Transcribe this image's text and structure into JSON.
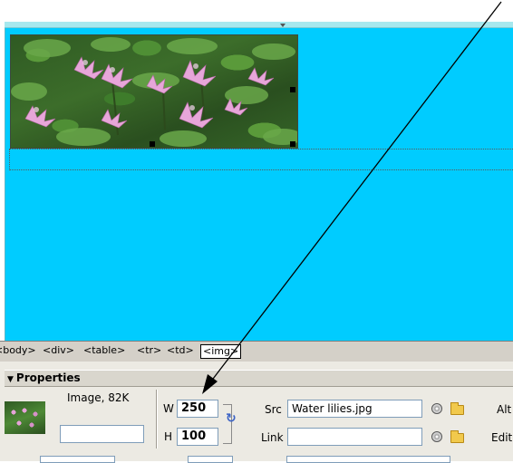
{
  "tag_selector": {
    "tags": [
      "<body>",
      "<div>",
      "<table>",
      "<tr>",
      "<td>"
    ],
    "selected_tag": "<img>"
  },
  "properties": {
    "title": "Properties",
    "image_type": "Image, 82K",
    "image_name": "",
    "width_label": "W",
    "width_value": "250",
    "height_label": "H",
    "height_value": "100",
    "src_label": "Src",
    "src_value": "Water lilies.jpg",
    "link_label": "Link",
    "link_value": "",
    "alt_label": "Alt",
    "edit_label": "Edit"
  },
  "icons": {
    "reset_size": "reset-size-icon",
    "point_to_file": "point-to-file-icon",
    "browse_folder": "folder-icon",
    "collapse": "triangle-down-icon"
  },
  "colors": {
    "design_background": "#00ccff",
    "panel": "#eceae3"
  }
}
